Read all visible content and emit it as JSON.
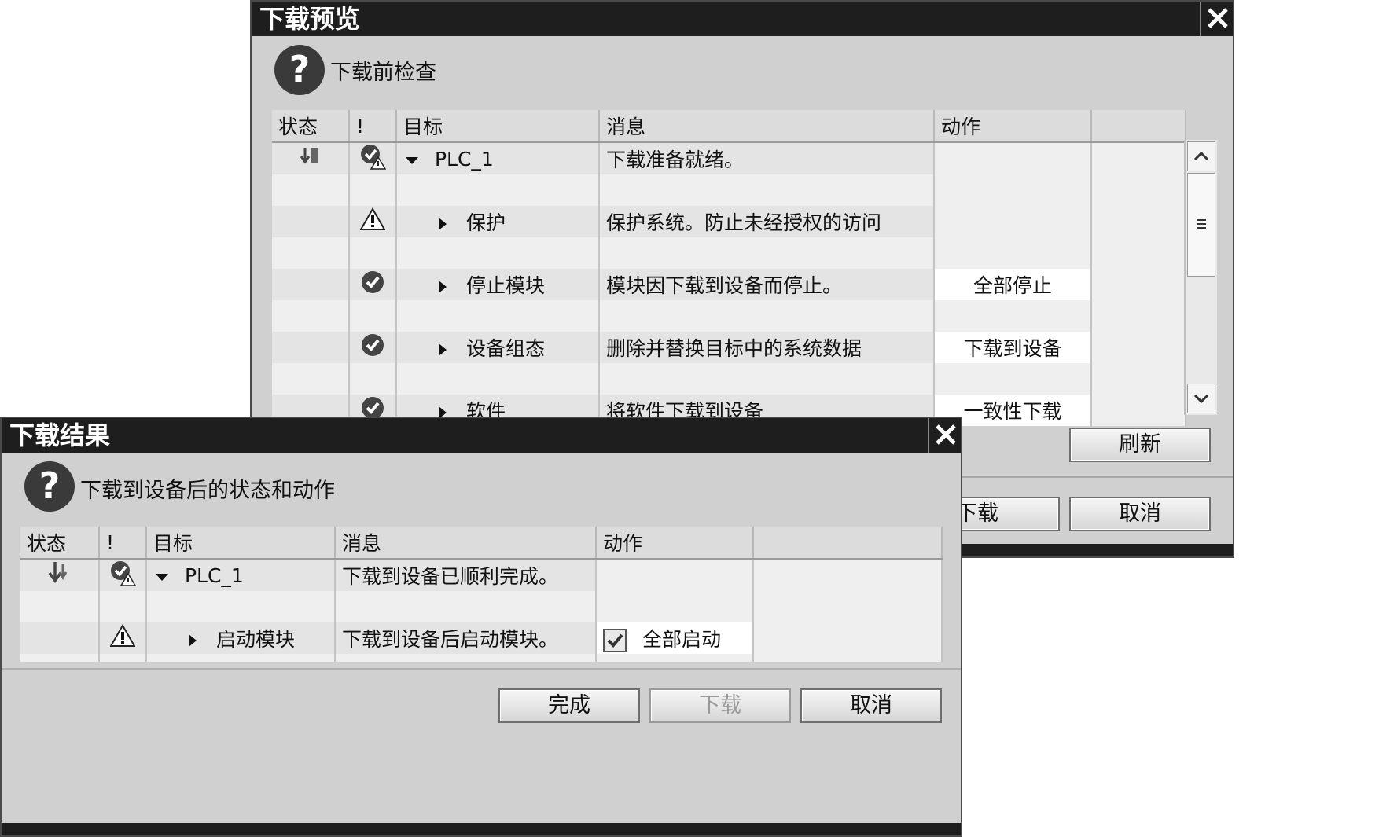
{
  "preview_dialog": {
    "title": "下载预览",
    "heading": "下载前检查",
    "columns": [
      "状态",
      "!",
      "目标",
      "消息",
      "动作",
      ""
    ],
    "rows": [
      {
        "target": "PLC_1",
        "message": "下载准备就绪。",
        "action": "",
        "status_icon": "download-status-icon",
        "check_icon": "check-warning-icon",
        "expanded": true
      },
      {
        "target": "保护",
        "message": "保护系统。防止未经授权的访问",
        "action": "",
        "check_icon": "warning-icon"
      },
      {
        "target": "停止模块",
        "message": "模块因下载到设备而停止。",
        "action": "全部停止",
        "check_icon": "check-icon"
      },
      {
        "target": "设备组态",
        "message": "删除并替换目标中的系统数据",
        "action": "下载到设备",
        "check_icon": "check-icon"
      },
      {
        "target": "软件",
        "message": "将软件下载到设备",
        "action": "一致性下载",
        "check_icon": "check-icon"
      }
    ],
    "buttons": {
      "refresh": "刷新",
      "download": "下载",
      "cancel": "取消"
    }
  },
  "result_dialog": {
    "title": "下载结果",
    "heading": "下载到设备后的状态和动作",
    "columns": [
      "状态",
      "!",
      "目标",
      "消息",
      "动作",
      ""
    ],
    "rows": [
      {
        "target": "PLC_1",
        "message": "下载到设备已顺利完成。",
        "action": "",
        "status_icon": "download-status-icon",
        "check_icon": "check-warning-icon",
        "expanded": true
      },
      {
        "target": "启动模块",
        "message": "下载到设备后启动模块。",
        "action": "全部启动",
        "checked": true,
        "check_icon": "warning-icon"
      }
    ],
    "buttons": {
      "finish": "完成",
      "download": "下载",
      "cancel": "取消"
    }
  }
}
